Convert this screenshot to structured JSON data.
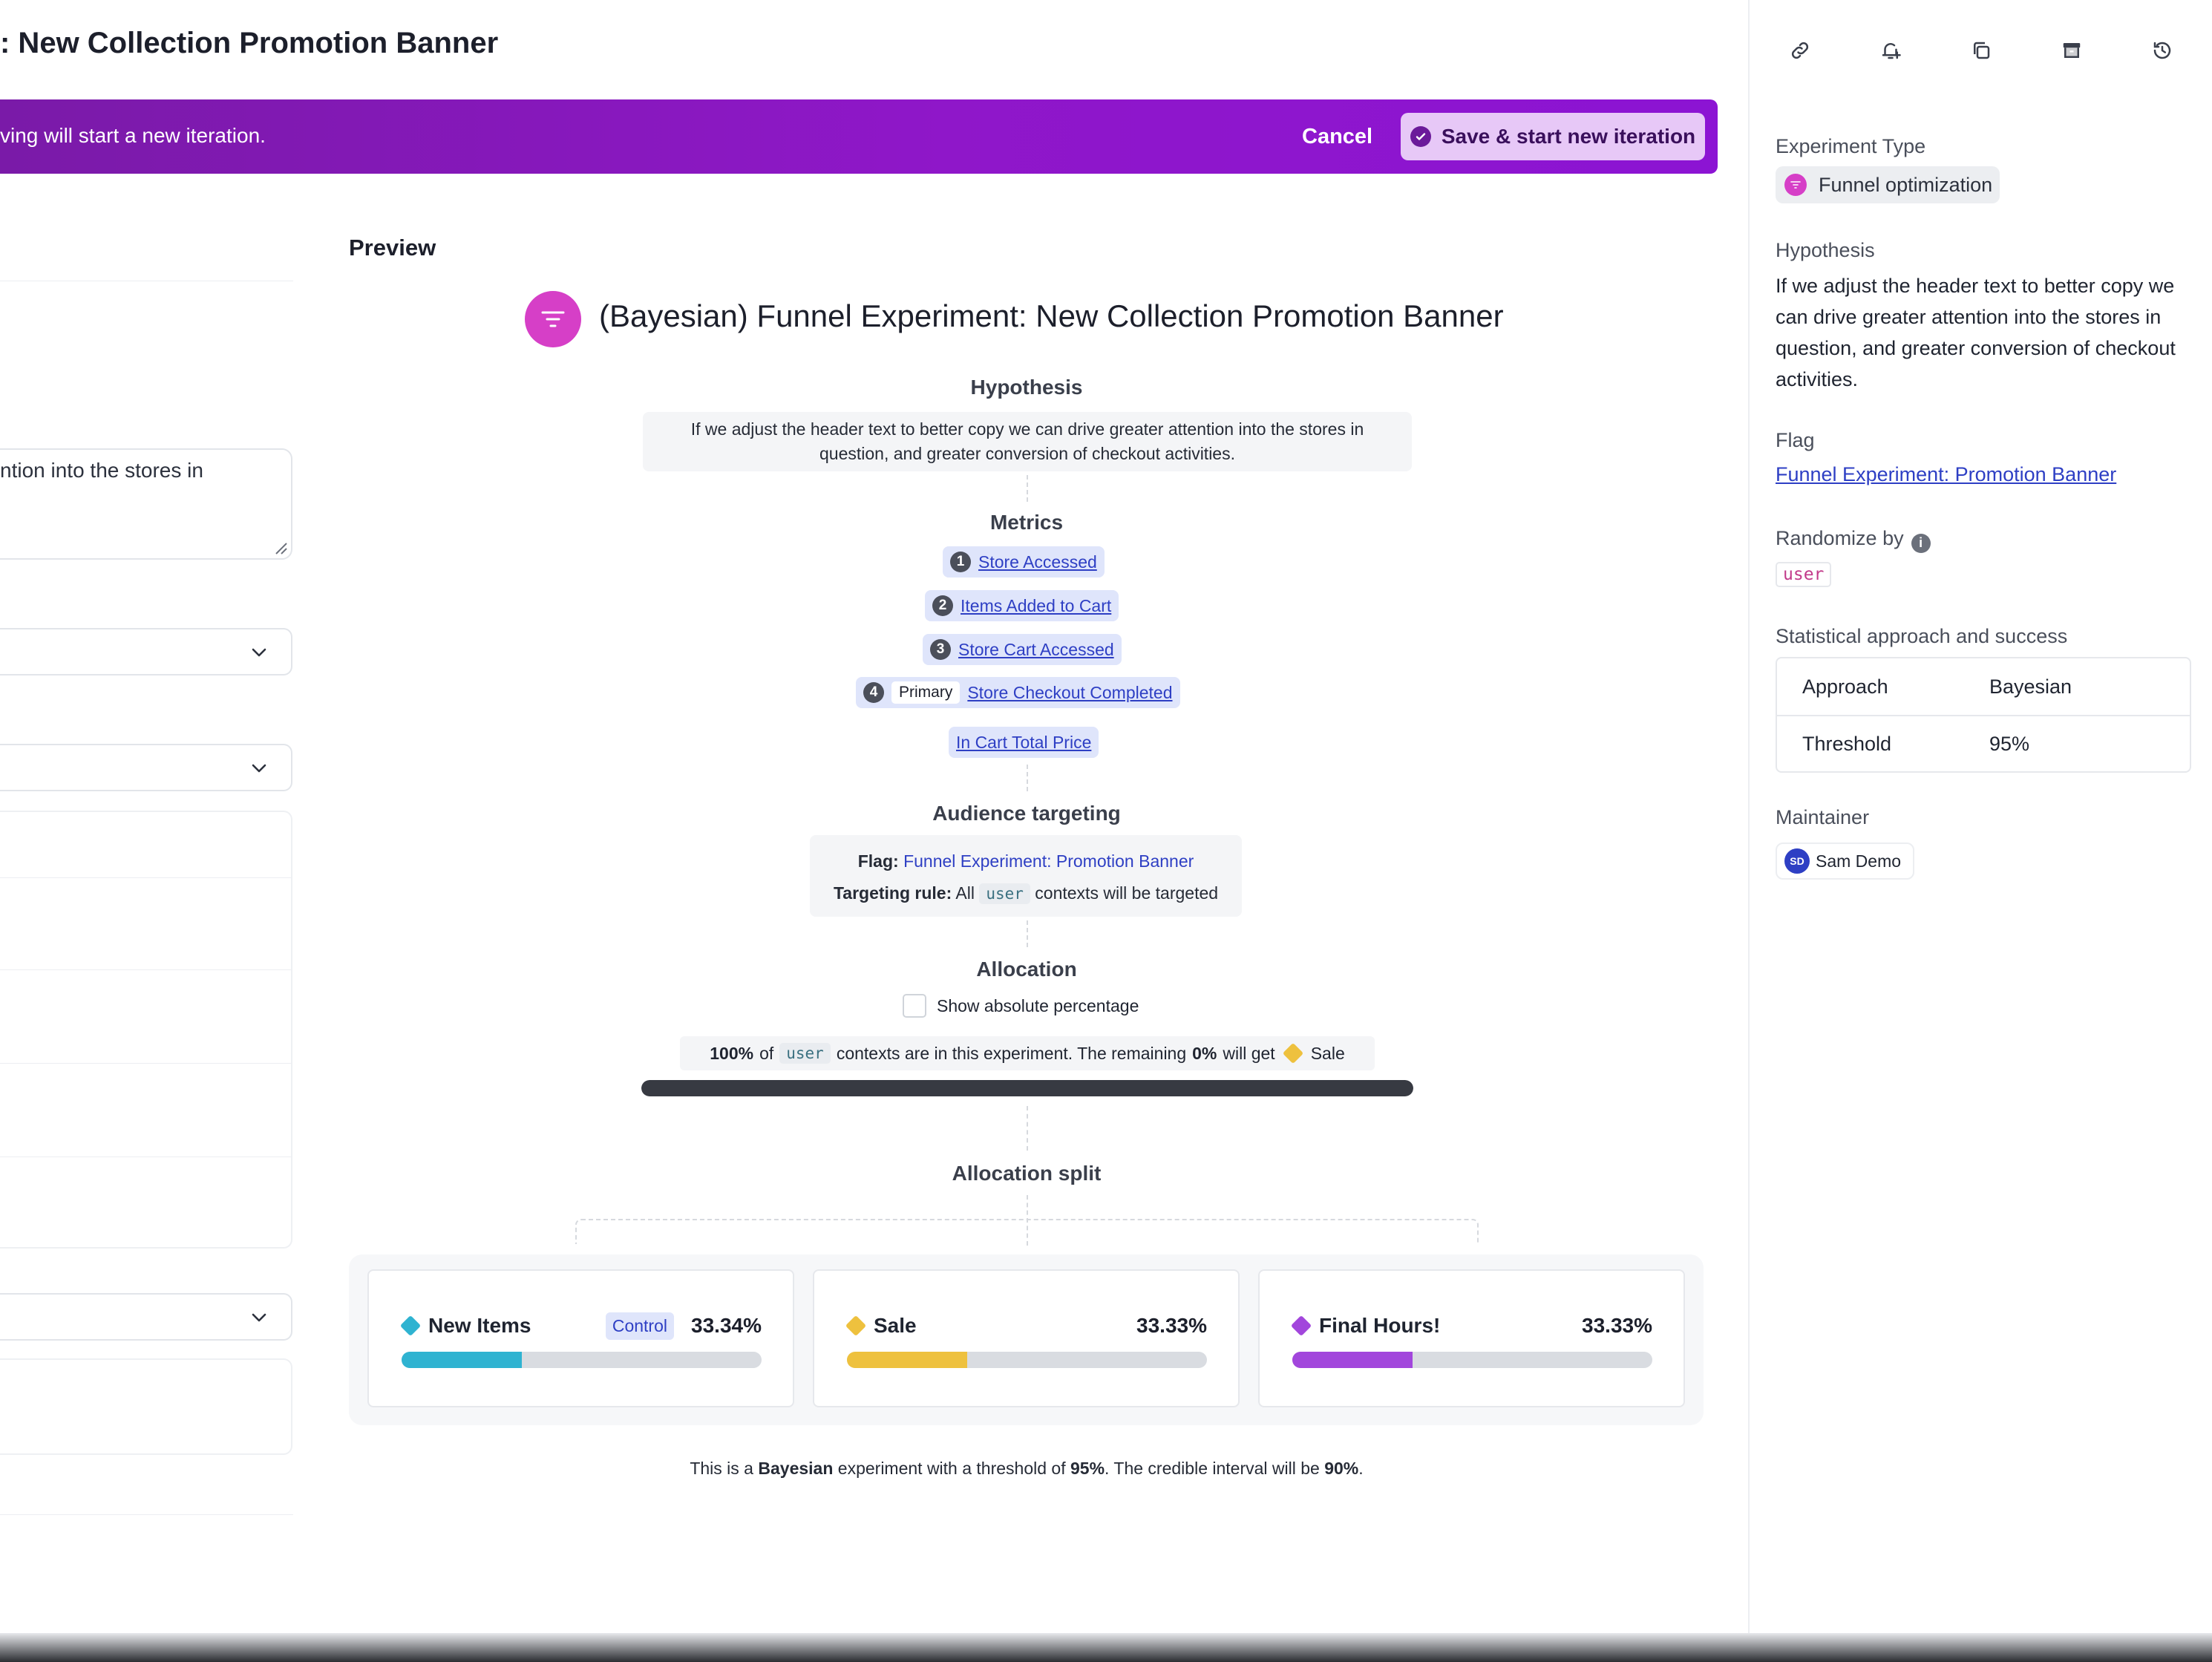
{
  "page": {
    "title": ": New Collection Promotion Banner"
  },
  "banner": {
    "message": "ving will start a new iteration.",
    "cancel_label": "Cancel",
    "save_label": "Save & start new iteration"
  },
  "form": {
    "textarea_visible_text": "ntion into the stores in"
  },
  "preview": {
    "label": "Preview",
    "experiment_title": "(Bayesian) Funnel Experiment: New Collection Promotion Banner",
    "hypothesis_heading": "Hypothesis",
    "hypothesis_line1": "If we adjust the header text to better copy we can drive greater attention into the stores in",
    "hypothesis_line2": "question, and greater conversion of checkout activities.",
    "metrics_heading": "Metrics",
    "metrics": [
      {
        "num": "1",
        "name": "Store Accessed"
      },
      {
        "num": "2",
        "name": "Items Added to Cart"
      },
      {
        "num": "3",
        "name": "Store Cart Accessed"
      },
      {
        "num": "4",
        "tag": "Primary",
        "name": "Store Checkout Completed"
      },
      {
        "name": "In Cart Total Price"
      }
    ],
    "audience_heading": "Audience targeting",
    "audience": {
      "flag_label": "Flag:",
      "flag_value": "Funnel Experiment: Promotion Banner",
      "rule_label": "Targeting rule:",
      "rule_prefix": "All",
      "rule_context": "user",
      "rule_suffix": "contexts will be targeted"
    },
    "allocation_heading": "Allocation",
    "allocation": {
      "abs_label": "Show absolute percentage",
      "pct": "100%",
      "of": "of",
      "context": "user",
      "middle": "contexts are in this experiment. The remaining",
      "remaining_pct": "0%",
      "will_get": "will get",
      "fallback": "Sale",
      "fill_fraction": 1.0
    },
    "split_heading": "Allocation split",
    "variations": [
      {
        "name": "New Items",
        "tag": "Control",
        "pct": "33.34%",
        "fraction": 0.3334,
        "color": "#2fb3d1"
      },
      {
        "name": "Sale",
        "pct": "33.33%",
        "fraction": 0.3333,
        "color": "#eec13e"
      },
      {
        "name": "Final Hours!",
        "pct": "33.33%",
        "fraction": 0.3333,
        "color": "#a246dc"
      }
    ],
    "footer": {
      "p1": "This is a",
      "b1": "Bayesian",
      "p2": "experiment with a threshold of",
      "b2": "95%",
      "p3": ". The credible interval will be",
      "b3": "90%",
      "p4": "."
    }
  },
  "sidebar": {
    "icons": [
      "link-icon",
      "bell-plus-icon",
      "copy-icon",
      "archive-icon",
      "history-icon"
    ],
    "experiment_type_label": "Experiment Type",
    "experiment_type_value": "Funnel optimization",
    "hypothesis_label": "Hypothesis",
    "hypothesis_text": "If we adjust the header text to better copy we can drive greater attention into the stores in question, and greater conversion of checkout activities.",
    "flag_label": "Flag",
    "flag_value": "Funnel Experiment: Promotion Banner",
    "randomize_label": "Randomize by",
    "randomize_value": "user",
    "stat_label": "Statistical approach and success",
    "stat_rows": [
      {
        "k": "Approach",
        "v": "Bayesian"
      },
      {
        "k": "Threshold",
        "v": "95%"
      }
    ],
    "maintainer_label": "Maintainer",
    "maintainer_initials": "SD",
    "maintainer_name": "Sam Demo"
  },
  "colors": {
    "accent": "#8f17c9",
    "link": "#2e3fc4",
    "funnel_pink": "#d63fc7"
  }
}
